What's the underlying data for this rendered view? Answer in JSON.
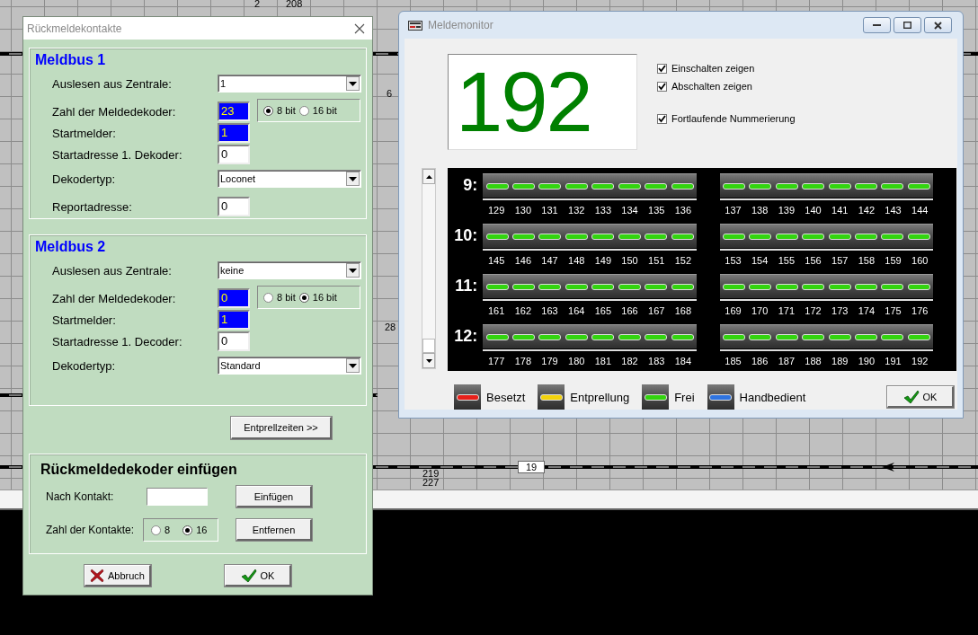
{
  "track_plan": {
    "labels": [
      {
        "text": "2"
      },
      {
        "text": "208"
      },
      {
        "text": "6"
      },
      {
        "text": "28"
      },
      {
        "text": "219"
      },
      {
        "text": "227"
      },
      {
        "text": "19"
      }
    ]
  },
  "dialog": {
    "title": "Rückmeldekontakte",
    "sections": [
      {
        "heading": "Meldbus 1",
        "rows": [
          {
            "kind": "select",
            "label": "Auslesen aus Zentrale:",
            "value": "1"
          },
          {
            "kind": "number",
            "label": "Zahl der Meldedekoder:",
            "value": "23",
            "highlighted": true,
            "bit_options": [
              {
                "label": "8 bit",
                "selected": true
              },
              {
                "label": "16 bit",
                "selected": false
              }
            ]
          },
          {
            "kind": "number",
            "label": "Startmelder:",
            "value": "1",
            "highlighted": true
          },
          {
            "kind": "number",
            "label": "Startadresse 1. Dekoder:",
            "value": "0",
            "highlighted": false
          },
          {
            "kind": "select",
            "label": "Dekodertyp:",
            "value": "Loconet"
          },
          {
            "kind": "number",
            "label": "Reportadresse:",
            "value": "0",
            "highlighted": false
          }
        ]
      },
      {
        "heading": "Meldbus 2",
        "rows": [
          {
            "kind": "select",
            "label": "Auslesen aus Zentrale:",
            "value": "keine"
          },
          {
            "kind": "number",
            "label": "Zahl der Meldedekoder:",
            "value": "0",
            "highlighted": true,
            "bit_options": [
              {
                "label": "8 bit",
                "selected": false
              },
              {
                "label": "16 bit",
                "selected": true
              }
            ]
          },
          {
            "kind": "number",
            "label": "Startmelder:",
            "value": "1",
            "highlighted": true
          },
          {
            "kind": "number",
            "label": "Startadresse 1. Decoder:",
            "value": "0",
            "highlighted": false
          },
          {
            "kind": "select",
            "label": "Dekodertyp:",
            "value": "Standard"
          }
        ]
      }
    ],
    "debounce_button": "Entprellzeiten >>",
    "insert": {
      "heading": "Rückmeldedekoder einfügen",
      "contact_label": "Nach Kontakt:",
      "insert_button": "Einfügen",
      "count_label": "Zahl der Kontakte:",
      "count_options": [
        {
          "label": "8",
          "selected": false
        },
        {
          "label": "16",
          "selected": true
        }
      ],
      "remove_button": "Entfernen"
    },
    "buttons": [
      {
        "kind": "cancel",
        "label": "Abbruch"
      },
      {
        "kind": "ok",
        "label": "OK"
      }
    ]
  },
  "monitor": {
    "title": "Meldemonitor",
    "counter": "192",
    "options": [
      {
        "label": "Einschalten zeigen",
        "checked": true
      },
      {
        "label": "Abschalten zeigen",
        "checked": true
      },
      {
        "label": "Fortlaufende Nummerierung",
        "checked": true
      }
    ],
    "rows": [
      {
        "label": "9:",
        "banks": [
          [
            {
              "number": "129",
              "color": "#33d40f"
            },
            {
              "number": "130",
              "color": "#33d40f"
            },
            {
              "number": "131",
              "color": "#33d40f"
            },
            {
              "number": "132",
              "color": "#33d40f"
            },
            {
              "number": "133",
              "color": "#33d40f"
            },
            {
              "number": "134",
              "color": "#33d40f"
            },
            {
              "number": "135",
              "color": "#33d40f"
            },
            {
              "number": "136",
              "color": "#33d40f"
            }
          ],
          [
            {
              "number": "137",
              "color": "#33d40f"
            },
            {
              "number": "138",
              "color": "#33d40f"
            },
            {
              "number": "139",
              "color": "#33d40f"
            },
            {
              "number": "140",
              "color": "#33d40f"
            },
            {
              "number": "141",
              "color": "#33d40f"
            },
            {
              "number": "142",
              "color": "#33d40f"
            },
            {
              "number": "143",
              "color": "#33d40f"
            },
            {
              "number": "144",
              "color": "#33d40f"
            }
          ]
        ]
      },
      {
        "label": "10:",
        "banks": [
          [
            {
              "number": "145",
              "color": "#33d40f"
            },
            {
              "number": "146",
              "color": "#33d40f"
            },
            {
              "number": "147",
              "color": "#33d40f"
            },
            {
              "number": "148",
              "color": "#33d40f"
            },
            {
              "number": "149",
              "color": "#33d40f"
            },
            {
              "number": "150",
              "color": "#33d40f"
            },
            {
              "number": "151",
              "color": "#33d40f"
            },
            {
              "number": "152",
              "color": "#33d40f"
            }
          ],
          [
            {
              "number": "153",
              "color": "#33d40f"
            },
            {
              "number": "154",
              "color": "#33d40f"
            },
            {
              "number": "155",
              "color": "#33d40f"
            },
            {
              "number": "156",
              "color": "#33d40f"
            },
            {
              "number": "157",
              "color": "#33d40f"
            },
            {
              "number": "158",
              "color": "#33d40f"
            },
            {
              "number": "159",
              "color": "#33d40f"
            },
            {
              "number": "160",
              "color": "#33d40f"
            }
          ]
        ]
      },
      {
        "label": "11:",
        "banks": [
          [
            {
              "number": "161",
              "color": "#33d40f"
            },
            {
              "number": "162",
              "color": "#33d40f"
            },
            {
              "number": "163",
              "color": "#33d40f"
            },
            {
              "number": "164",
              "color": "#33d40f"
            },
            {
              "number": "165",
              "color": "#33d40f"
            },
            {
              "number": "166",
              "color": "#33d40f"
            },
            {
              "number": "167",
              "color": "#33d40f"
            },
            {
              "number": "168",
              "color": "#33d40f"
            }
          ],
          [
            {
              "number": "169",
              "color": "#33d40f"
            },
            {
              "number": "170",
              "color": "#33d40f"
            },
            {
              "number": "171",
              "color": "#33d40f"
            },
            {
              "number": "172",
              "color": "#33d40f"
            },
            {
              "number": "173",
              "color": "#33d40f"
            },
            {
              "number": "174",
              "color": "#33d40f"
            },
            {
              "number": "175",
              "color": "#33d40f"
            },
            {
              "number": "176",
              "color": "#33d40f"
            }
          ]
        ]
      },
      {
        "label": "12:",
        "banks": [
          [
            {
              "number": "177",
              "color": "#33d40f"
            },
            {
              "number": "178",
              "color": "#33d40f"
            },
            {
              "number": "179",
              "color": "#33d40f"
            },
            {
              "number": "180",
              "color": "#33d40f"
            },
            {
              "number": "181",
              "color": "#33d40f"
            },
            {
              "number": "182",
              "color": "#33d40f"
            },
            {
              "number": "183",
              "color": "#33d40f"
            },
            {
              "number": "184",
              "color": "#33d40f"
            }
          ],
          [
            {
              "number": "185",
              "color": "#33d40f"
            },
            {
              "number": "186",
              "color": "#33d40f"
            },
            {
              "number": "187",
              "color": "#33d40f"
            },
            {
              "number": "188",
              "color": "#33d40f"
            },
            {
              "number": "189",
              "color": "#33d40f"
            },
            {
              "number": "190",
              "color": "#33d40f"
            },
            {
              "number": "191",
              "color": "#33d40f"
            },
            {
              "number": "192",
              "color": "#33d40f"
            }
          ]
        ]
      }
    ],
    "legend": [
      {
        "label": "Besetzt",
        "color": "#e8201a"
      },
      {
        "label": "Entprellung",
        "color": "#f2d20c"
      },
      {
        "label": "Frei",
        "color": "#33d40f"
      },
      {
        "label": "Handbedient",
        "color": "#2f74e0"
      }
    ],
    "ok_button": "OK"
  }
}
